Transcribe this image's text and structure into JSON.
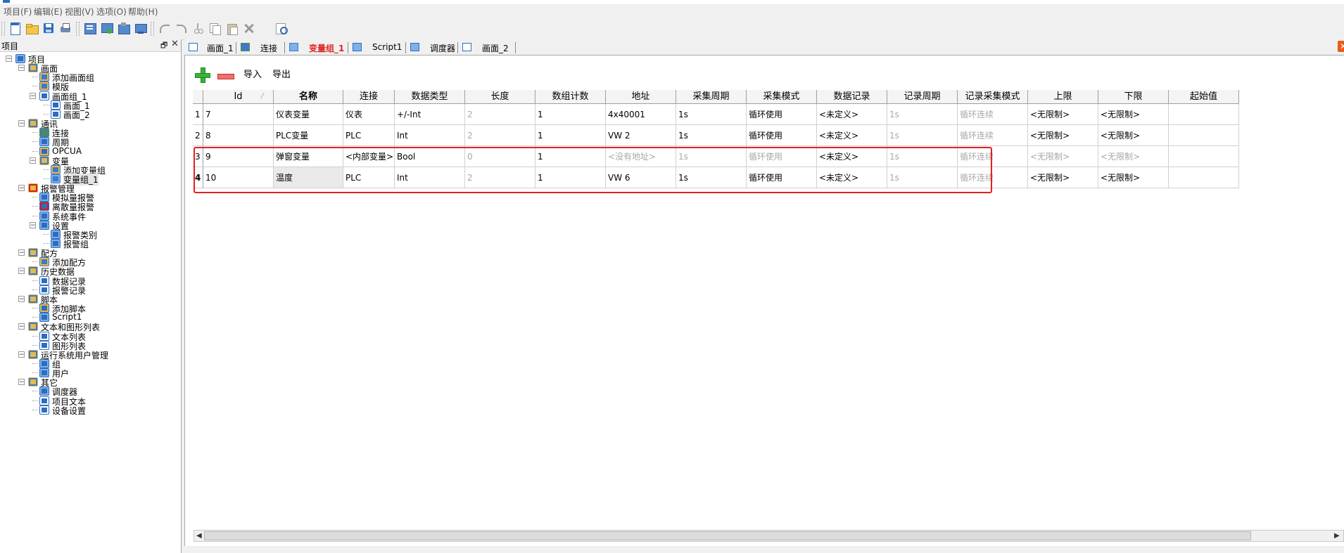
{
  "menubar": [
    "项目(F)",
    "编辑(E)",
    "视图(V)",
    "选项(O)",
    "帮助(H)"
  ],
  "panel": {
    "title": "项目",
    "tree": [
      {
        "label": "项目",
        "level": 0,
        "icon": "project-icon",
        "toggle": "minus"
      },
      {
        "label": "画面",
        "level": 1,
        "icon": "screen-folder-icon",
        "toggle": "minus"
      },
      {
        "label": "添加画面组",
        "level": 2,
        "icon": "add-screen-group-icon"
      },
      {
        "label": "模版",
        "level": 2,
        "icon": "template-icon"
      },
      {
        "label": "画面组_1",
        "level": 2,
        "icon": "screen-group-icon",
        "toggle": "minus"
      },
      {
        "label": "画面_1",
        "level": 3,
        "icon": "screen-icon"
      },
      {
        "label": "画面_2",
        "level": 3,
        "icon": "screen-icon"
      },
      {
        "label": "通讯",
        "level": 1,
        "icon": "communication-folder-icon",
        "toggle": "minus"
      },
      {
        "label": "连接",
        "level": 2,
        "icon": "connection-icon"
      },
      {
        "label": "周期",
        "level": 2,
        "icon": "cycle-icon"
      },
      {
        "label": "OPCUA",
        "level": 2,
        "icon": "opcua-icon"
      },
      {
        "label": "变量",
        "level": 2,
        "icon": "variable-folder-icon",
        "toggle": "minus"
      },
      {
        "label": "添加变量组",
        "level": 3,
        "icon": "add-variable-group-icon"
      },
      {
        "label": "变量组_1",
        "level": 3,
        "icon": "variable-group-icon",
        "selected": true
      },
      {
        "label": "报警管理",
        "level": 1,
        "icon": "alarm-folder-icon",
        "toggle": "minus"
      },
      {
        "label": "模拟量报警",
        "level": 2,
        "icon": "analog-alarm-icon"
      },
      {
        "label": "离散量报警",
        "level": 2,
        "icon": "discrete-alarm-icon"
      },
      {
        "label": "系统事件",
        "level": 2,
        "icon": "system-event-icon"
      },
      {
        "label": "设置",
        "level": 2,
        "icon": "settings-icon",
        "toggle": "minus"
      },
      {
        "label": "报警类别",
        "level": 3,
        "icon": "alarm-class-icon"
      },
      {
        "label": "报警组",
        "level": 3,
        "icon": "alarm-group-icon"
      },
      {
        "label": "配方",
        "level": 1,
        "icon": "recipe-folder-icon",
        "toggle": "minus"
      },
      {
        "label": "添加配方",
        "level": 2,
        "icon": "add-recipe-icon"
      },
      {
        "label": "历史数据",
        "level": 1,
        "icon": "history-folder-icon",
        "toggle": "minus"
      },
      {
        "label": "数据记录",
        "level": 2,
        "icon": "data-log-icon"
      },
      {
        "label": "报警记录",
        "level": 2,
        "icon": "alarm-log-icon"
      },
      {
        "label": "脚本",
        "level": 1,
        "icon": "script-folder-icon",
        "toggle": "minus"
      },
      {
        "label": "添加脚本",
        "level": 2,
        "icon": "add-script-icon"
      },
      {
        "label": "Script1",
        "level": 2,
        "icon": "script-icon"
      },
      {
        "label": "文本和图形列表",
        "level": 1,
        "icon": "list-folder-icon",
        "toggle": "minus"
      },
      {
        "label": "文本列表",
        "level": 2,
        "icon": "text-list-icon"
      },
      {
        "label": "图形列表",
        "level": 2,
        "icon": "graphic-list-icon"
      },
      {
        "label": "运行系统用户管理",
        "level": 1,
        "icon": "user-admin-folder-icon",
        "toggle": "minus"
      },
      {
        "label": "组",
        "level": 2,
        "icon": "group-icon"
      },
      {
        "label": "用户",
        "level": 2,
        "icon": "user-icon"
      },
      {
        "label": "其它",
        "level": 1,
        "icon": "other-folder-icon",
        "toggle": "minus"
      },
      {
        "label": "调度器",
        "level": 2,
        "icon": "scheduler-icon"
      },
      {
        "label": "项目文本",
        "level": 2,
        "icon": "project-text-icon"
      },
      {
        "label": "设备设置",
        "level": 2,
        "icon": "device-settings-icon"
      }
    ]
  },
  "tabs": [
    {
      "label": "画面_1",
      "icon": "screen-icon"
    },
    {
      "label": "连接",
      "icon": "connection-icon"
    },
    {
      "label": "变量组_1",
      "icon": "variable-group-icon",
      "active": true
    },
    {
      "label": "Script1",
      "icon": "script-icon"
    },
    {
      "label": "调度器",
      "icon": "scheduler-icon"
    },
    {
      "label": "画面_2",
      "icon": "screen-icon"
    }
  ],
  "actions": {
    "import_label": "导入",
    "export_label": "导出"
  },
  "table": {
    "columns": [
      "Id",
      "名称",
      "连接",
      "数据类型",
      "长度",
      "数组计数",
      "地址",
      "采集周期",
      "采集模式",
      "数据记录",
      "记录周期",
      "记录采集模式",
      "上限",
      "下限",
      "起始值"
    ],
    "rows": [
      {
        "num": "1",
        "cells": [
          "7",
          "仪表变量",
          "仪表",
          "+/-Int",
          "2",
          "1",
          "4x40001",
          "1s",
          "循环使用",
          "<未定义>",
          "1s",
          "循环连续",
          "<无限制>",
          "<无限制>",
          ""
        ],
        "gray": [
          4,
          10,
          11
        ]
      },
      {
        "num": "2",
        "cells": [
          "8",
          "PLC变量",
          "PLC",
          "Int",
          "2",
          "1",
          "VW 2",
          "1s",
          "循环使用",
          "<未定义>",
          "1s",
          "循环连续",
          "<无限制>",
          "<无限制>",
          ""
        ],
        "gray": [
          4,
          10,
          11
        ]
      },
      {
        "num": "3",
        "cells": [
          "9",
          "弹窗变量",
          "<内部变量>",
          "Bool",
          "0",
          "1",
          "<没有地址>",
          "1s",
          "循环使用",
          "<未定义>",
          "1s",
          "循环连续",
          "<无限制>",
          "<无限制>",
          ""
        ],
        "gray": [
          4,
          6,
          7,
          8,
          10,
          11,
          12,
          13
        ]
      },
      {
        "num": "4",
        "cells": [
          "10",
          "温度",
          "PLC",
          "Int",
          "2",
          "1",
          "VW 6",
          "1s",
          "循环使用",
          "<未定义>",
          "1s",
          "循环连续",
          "<无限制>",
          "<无限制>",
          ""
        ],
        "gray": [
          4,
          10,
          11
        ],
        "current": true
      }
    ]
  },
  "colors": {
    "active_tab": "#e02020",
    "highlight_border": "#e32020",
    "close_button": "#e85c1c"
  }
}
